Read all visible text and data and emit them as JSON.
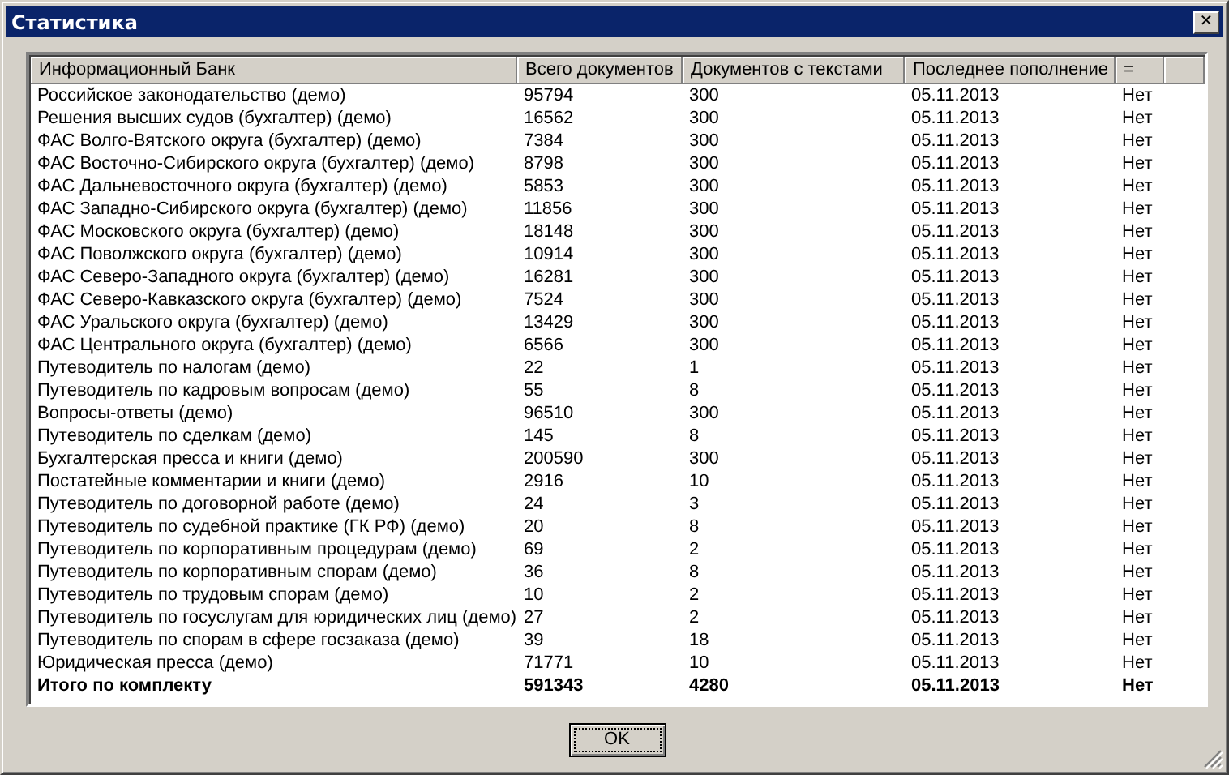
{
  "window": {
    "title": "Статистика",
    "close": "✕"
  },
  "table": {
    "columns": [
      "Информационный Банк",
      "Всего документов",
      "Документов с текстами",
      "Последнее пополнение",
      "="
    ],
    "rows": [
      {
        "kind": "item",
        "cells": [
          "Российское законодательство (демо)",
          "95794",
          "300",
          "05.11.2013",
          "Нет"
        ]
      },
      {
        "kind": "item",
        "cells": [
          "Решения высших судов (бухгалтер) (демо)",
          "16562",
          "300",
          "05.11.2013",
          "Нет"
        ]
      },
      {
        "kind": "item",
        "cells": [
          "ФАС Волго-Вятского округа (бухгалтер) (демо)",
          "7384",
          "300",
          "05.11.2013",
          "Нет"
        ]
      },
      {
        "kind": "item",
        "cells": [
          "ФАС Восточно-Сибирского округа (бухгалтер) (демо)",
          "8798",
          "300",
          "05.11.2013",
          "Нет"
        ]
      },
      {
        "kind": "item",
        "cells": [
          "ФАС Дальневосточного округа (бухгалтер) (демо)",
          "5853",
          "300",
          "05.11.2013",
          "Нет"
        ]
      },
      {
        "kind": "item",
        "cells": [
          "ФАС Западно-Сибирского округа (бухгалтер) (демо)",
          "11856",
          "300",
          "05.11.2013",
          "Нет"
        ]
      },
      {
        "kind": "item",
        "cells": [
          "ФАС Московского округа (бухгалтер) (демо)",
          "18148",
          "300",
          "05.11.2013",
          "Нет"
        ]
      },
      {
        "kind": "item",
        "cells": [
          "ФАС Поволжского округа (бухгалтер) (демо)",
          "10914",
          "300",
          "05.11.2013",
          "Нет"
        ]
      },
      {
        "kind": "item",
        "cells": [
          "ФАС Северо-Западного округа (бухгалтер) (демо)",
          "16281",
          "300",
          "05.11.2013",
          "Нет"
        ]
      },
      {
        "kind": "item",
        "cells": [
          "ФАС Северо-Кавказского округа (бухгалтер) (демо)",
          "7524",
          "300",
          "05.11.2013",
          "Нет"
        ]
      },
      {
        "kind": "item",
        "cells": [
          "ФАС Уральского округа (бухгалтер) (демо)",
          "13429",
          "300",
          "05.11.2013",
          "Нет"
        ]
      },
      {
        "kind": "item",
        "cells": [
          "ФАС Центрального округа (бухгалтер) (демо)",
          "6566",
          "300",
          "05.11.2013",
          "Нет"
        ]
      },
      {
        "kind": "item",
        "cells": [
          "Путеводитель по налогам (демо)",
          "22",
          "1",
          "05.11.2013",
          "Нет"
        ]
      },
      {
        "kind": "item",
        "cells": [
          "Путеводитель по кадровым вопросам (демо)",
          "55",
          "8",
          "05.11.2013",
          "Нет"
        ]
      },
      {
        "kind": "item",
        "cells": [
          "Вопросы-ответы (демо)",
          "96510",
          "300",
          "05.11.2013",
          "Нет"
        ]
      },
      {
        "kind": "item",
        "cells": [
          "Путеводитель по сделкам (демо)",
          "145",
          "8",
          "05.11.2013",
          "Нет"
        ]
      },
      {
        "kind": "item",
        "cells": [
          "Бухгалтерская пресса и книги (демо)",
          "200590",
          "300",
          "05.11.2013",
          "Нет"
        ]
      },
      {
        "kind": "item",
        "cells": [
          "Постатейные комментарии и книги (демо)",
          "2916",
          "10",
          "05.11.2013",
          "Нет"
        ]
      },
      {
        "kind": "item",
        "cells": [
          "Путеводитель по договорной работе (демо)",
          "24",
          "3",
          "05.11.2013",
          "Нет"
        ]
      },
      {
        "kind": "item",
        "cells": [
          "Путеводитель по судебной практике (ГК РФ) (демо)",
          "20",
          "8",
          "05.11.2013",
          "Нет"
        ]
      },
      {
        "kind": "item",
        "cells": [
          "Путеводитель по корпоративным процедурам (демо)",
          "69",
          "2",
          "05.11.2013",
          "Нет"
        ]
      },
      {
        "kind": "item",
        "cells": [
          "Путеводитель по корпоративным спорам (демо)",
          "36",
          "8",
          "05.11.2013",
          "Нет"
        ]
      },
      {
        "kind": "item",
        "cells": [
          "Путеводитель по трудовым спорам (демо)",
          "10",
          "2",
          "05.11.2013",
          "Нет"
        ]
      },
      {
        "kind": "item",
        "cells": [
          "Путеводитель по госуслугам для юридических лиц (демо)",
          "27",
          "2",
          "05.11.2013",
          "Нет"
        ]
      },
      {
        "kind": "item",
        "cells": [
          "Путеводитель по спорам в сфере госзаказа (демо)",
          "39",
          "18",
          "05.11.2013",
          "Нет"
        ]
      },
      {
        "kind": "item",
        "cells": [
          "Юридическая пресса (демо)",
          "71771",
          "10",
          "05.11.2013",
          "Нет"
        ]
      },
      {
        "kind": "total",
        "cells": [
          "Итого по комплекту",
          "591343",
          "4280",
          "05.11.2013",
          "Нет"
        ]
      }
    ]
  },
  "buttons": [
    {
      "label": "OK",
      "focused": true
    }
  ]
}
